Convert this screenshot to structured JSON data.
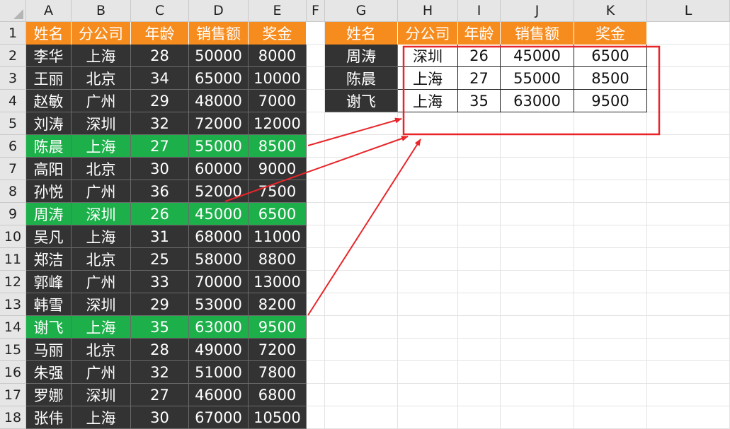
{
  "columns": [
    "A",
    "B",
    "C",
    "D",
    "E",
    "F",
    "G",
    "H",
    "I",
    "J",
    "K",
    "L"
  ],
  "row_numbers": [
    "1",
    "2",
    "3",
    "4",
    "5",
    "6",
    "7",
    "8",
    "9",
    "10",
    "11",
    "12",
    "13",
    "14",
    "15",
    "16",
    "17",
    "18"
  ],
  "left_table": {
    "header": [
      "姓名",
      "分公司",
      "年龄",
      "销售额",
      "奖金"
    ],
    "rows": [
      [
        "李华",
        "上海",
        "28",
        "50000",
        "8000"
      ],
      [
        "王丽",
        "北京",
        "34",
        "65000",
        "10000"
      ],
      [
        "赵敏",
        "广州",
        "29",
        "48000",
        "7000"
      ],
      [
        "刘涛",
        "深圳",
        "32",
        "72000",
        "12000"
      ],
      [
        "陈晨",
        "上海",
        "27",
        "55000",
        "8500"
      ],
      [
        "高阳",
        "北京",
        "30",
        "60000",
        "9000"
      ],
      [
        "孙悦",
        "广州",
        "36",
        "52000",
        "7500"
      ],
      [
        "周涛",
        "深圳",
        "26",
        "45000",
        "6500"
      ],
      [
        "吴凡",
        "上海",
        "31",
        "68000",
        "11000"
      ],
      [
        "郑洁",
        "北京",
        "25",
        "58000",
        "8800"
      ],
      [
        "郭峰",
        "广州",
        "33",
        "70000",
        "13000"
      ],
      [
        "韩雪",
        "深圳",
        "29",
        "53000",
        "8200"
      ],
      [
        "谢飞",
        "上海",
        "35",
        "63000",
        "9500"
      ],
      [
        "马丽",
        "北京",
        "28",
        "49000",
        "7200"
      ],
      [
        "朱强",
        "广州",
        "32",
        "51000",
        "7800"
      ],
      [
        "罗娜",
        "深圳",
        "27",
        "46000",
        "6800"
      ],
      [
        "张伟",
        "上海",
        "30",
        "67000",
        "10500"
      ]
    ],
    "highlighted_rows": [
      4,
      7,
      12
    ]
  },
  "right_table": {
    "header": [
      "姓名",
      "分公司",
      "年龄",
      "销售额",
      "奖金"
    ],
    "rows": [
      [
        "周涛",
        "深圳",
        "26",
        "45000",
        "6500"
      ],
      [
        "陈晨",
        "上海",
        "27",
        "55000",
        "8500"
      ],
      [
        "谢飞",
        "上海",
        "35",
        "63000",
        "9500"
      ]
    ]
  },
  "colors": {
    "header_orange": "#f78c1e",
    "dark_fill": "#333333",
    "highlight_green": "#1db04a",
    "annotation_red": "#e8262a"
  }
}
